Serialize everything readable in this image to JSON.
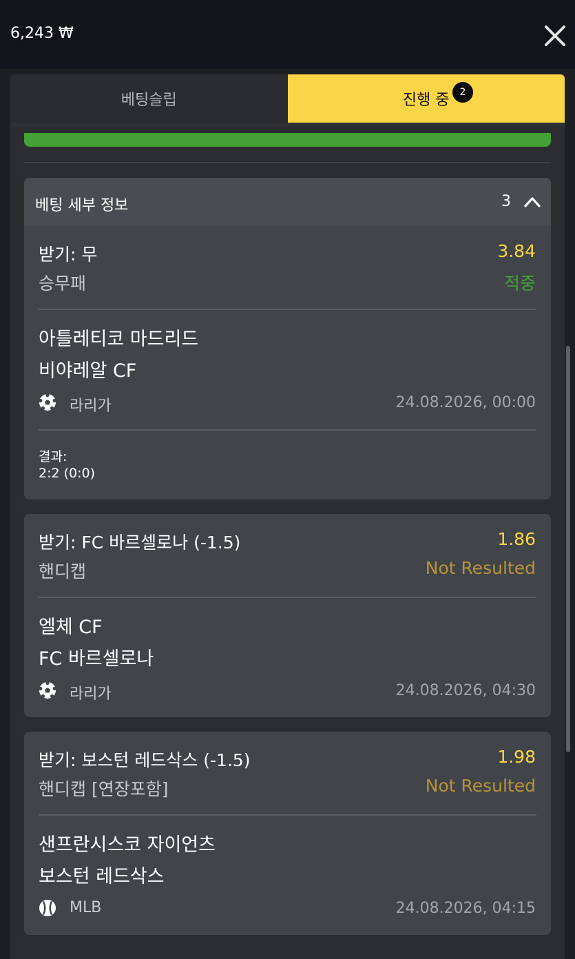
{
  "header": {
    "balance": "6,243 ₩"
  },
  "tabs": [
    {
      "label": "베팅슬립",
      "active": false
    },
    {
      "label": "진행 중",
      "active": true,
      "badge": "2"
    }
  ],
  "details": {
    "title": "베팅 세부 정보",
    "count": "3"
  },
  "colors": {
    "accent": "#fad546",
    "win": "#45a136",
    "pending": "#b8923a",
    "panel": "#2b2d31",
    "card": "#414449"
  },
  "bets": [
    {
      "pick": "받기: 무",
      "market": "승무패",
      "odds": "3.84",
      "status": "적중",
      "team1": "아틀레티코 마드리드",
      "team2": "비야레알 CF",
      "sport_icon": "soccer-ball-icon",
      "league": "라리가",
      "datetime": "24.08.2026, 00:00",
      "result_label": "결과:",
      "result_value": "2:2 (0:0)"
    },
    {
      "pick": "받기: FC 바르셀로나 (-1.5)",
      "market": "핸디캡",
      "odds": "1.86",
      "status": "Not Resulted",
      "team1": "엘체 CF",
      "team2": "FC 바르셀로나",
      "sport_icon": "soccer-ball-icon",
      "league": "라리가",
      "datetime": "24.08.2026, 04:30"
    },
    {
      "pick": "받기: 보스턴 레드삭스 (-1.5)",
      "market": "핸디캡 [연장포함]",
      "odds": "1.98",
      "status": "Not Resulted",
      "team1": "샌프란시스코 자이언츠",
      "team2": "보스턴 레드삭스",
      "sport_icon": "baseball-icon",
      "league": "MLB",
      "datetime": "24.08.2026, 04:15"
    }
  ]
}
